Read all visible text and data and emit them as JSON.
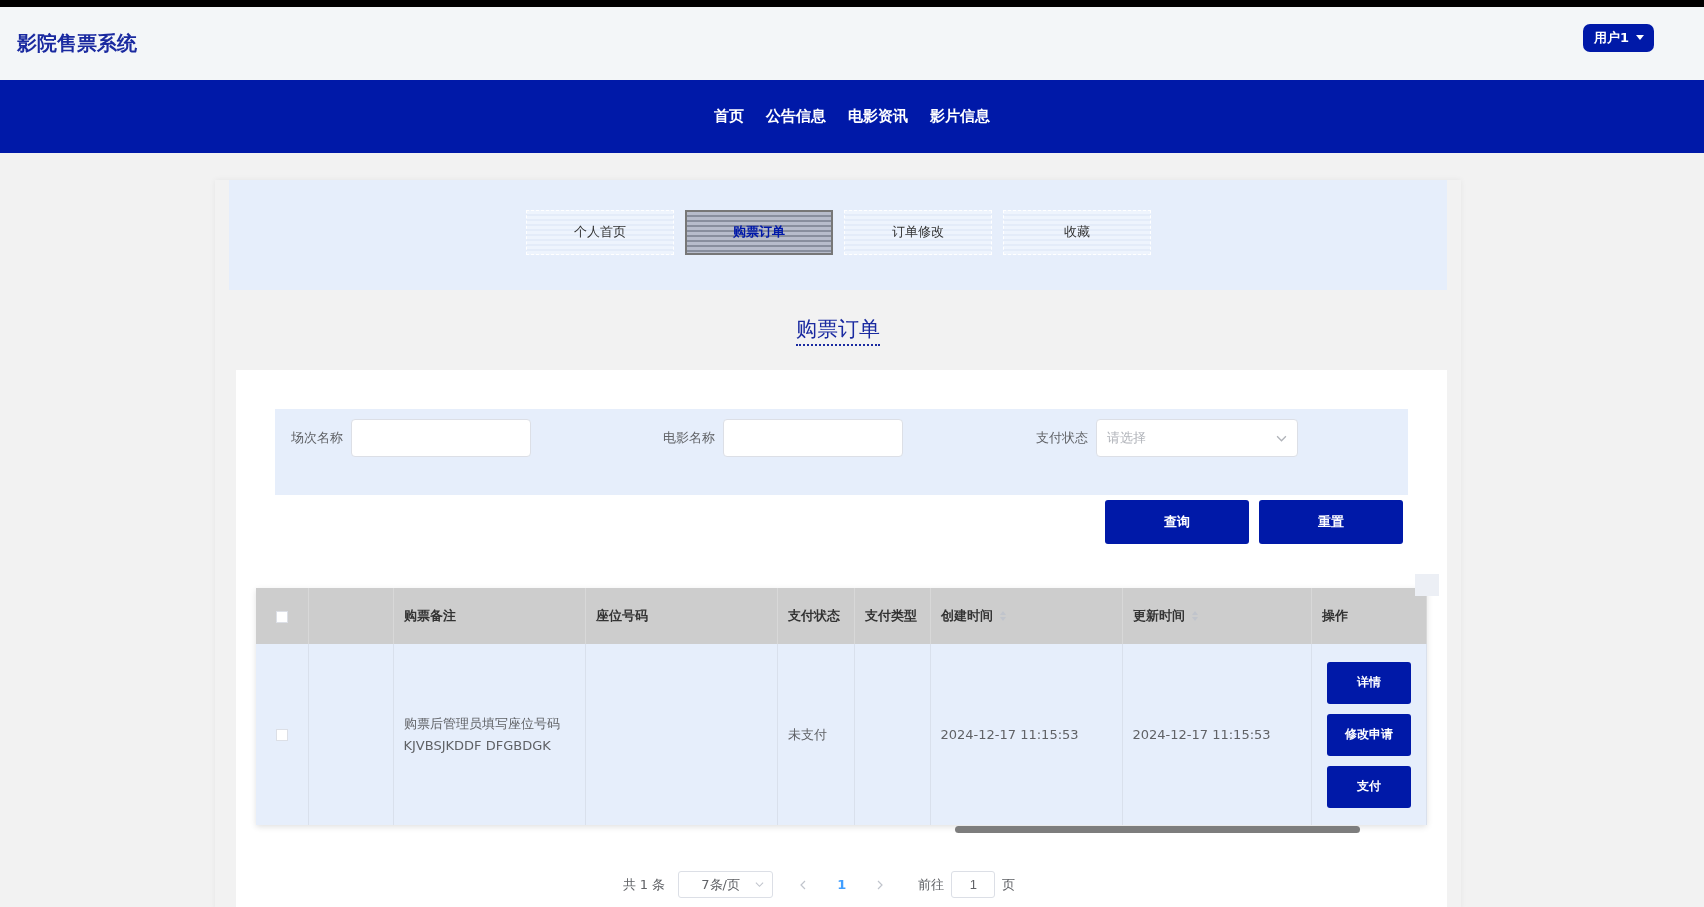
{
  "header": {
    "title": "影院售票系统",
    "user_menu": "用户1"
  },
  "nav": [
    {
      "label": "首页"
    },
    {
      "label": "公告信息"
    },
    {
      "label": "电影资讯"
    },
    {
      "label": "影片信息"
    }
  ],
  "tabs": [
    {
      "label": "个人首页",
      "selected": false
    },
    {
      "label": "购票订单",
      "selected": true
    },
    {
      "label": "订单修改",
      "selected": false
    },
    {
      "label": "收藏",
      "selected": false
    }
  ],
  "page_heading": "购票订单",
  "filters": [
    {
      "kind": "input",
      "label": "场次名称"
    },
    {
      "kind": "input",
      "label": "电影名称"
    },
    {
      "kind": "select",
      "label": "支付状态",
      "placeholder": "请选择"
    }
  ],
  "filter_buttons": [
    "查询",
    "重置"
  ],
  "table": {
    "select_all_checked": false,
    "columns": [
      {
        "sortable": false
      },
      {
        "label": "购票备注",
        "sortable": false
      },
      {
        "label": "座位号码",
        "sortable": false
      },
      {
        "label": "支付状态",
        "sortable": false
      },
      {
        "label": "支付类型",
        "sortable": false
      },
      {
        "label": "创建时间",
        "sortable": true
      },
      {
        "label": "更新时间",
        "sortable": true
      },
      {
        "label": "操作",
        "sortable": false
      }
    ],
    "rows": [
      {
        "checked": false,
        "cells": [
          "",
          "购票后管理员填写座位号码KJVBSJKDDF DFGBDGK",
          "",
          "未支付",
          "",
          "2024-12-17 11:15:53",
          "2024-12-17 11:15:53"
        ],
        "actions": [
          "详情",
          "修改申请",
          "支付"
        ]
      }
    ]
  },
  "pagination": {
    "total": "共 1 条",
    "page_size": "7条/页",
    "pages": [
      {
        "label": "1",
        "selected": true
      }
    ],
    "goto_label": "前往",
    "goto_value": "1",
    "goto_suffix": "页"
  }
}
